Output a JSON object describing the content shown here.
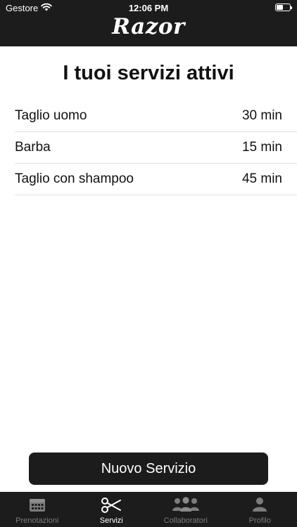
{
  "status_bar": {
    "carrier": "Gestore",
    "time": "12:06 PM"
  },
  "header": {
    "logo_text": "Razor"
  },
  "main": {
    "title": "I tuoi servizi attivi",
    "services": [
      {
        "name": "Taglio uomo",
        "duration": "30 min"
      },
      {
        "name": "Barba",
        "duration": "15 min"
      },
      {
        "name": "Taglio con shampoo",
        "duration": "45 min"
      }
    ],
    "new_service_label": "Nuovo Servizio"
  },
  "tab_bar": {
    "tabs": [
      {
        "label": "Prenotazioni",
        "icon": "calendar-icon",
        "active": false
      },
      {
        "label": "Servizi",
        "icon": "scissors-icon",
        "active": true
      },
      {
        "label": "Collaboratori",
        "icon": "group-icon",
        "active": false
      },
      {
        "label": "Profilo",
        "icon": "person-icon",
        "active": false
      }
    ]
  },
  "colors": {
    "bar_background": "#1c1c1c",
    "active_tab": "#ffffff",
    "inactive_tab": "#7c7c7c",
    "divider": "#e2e2e2"
  }
}
